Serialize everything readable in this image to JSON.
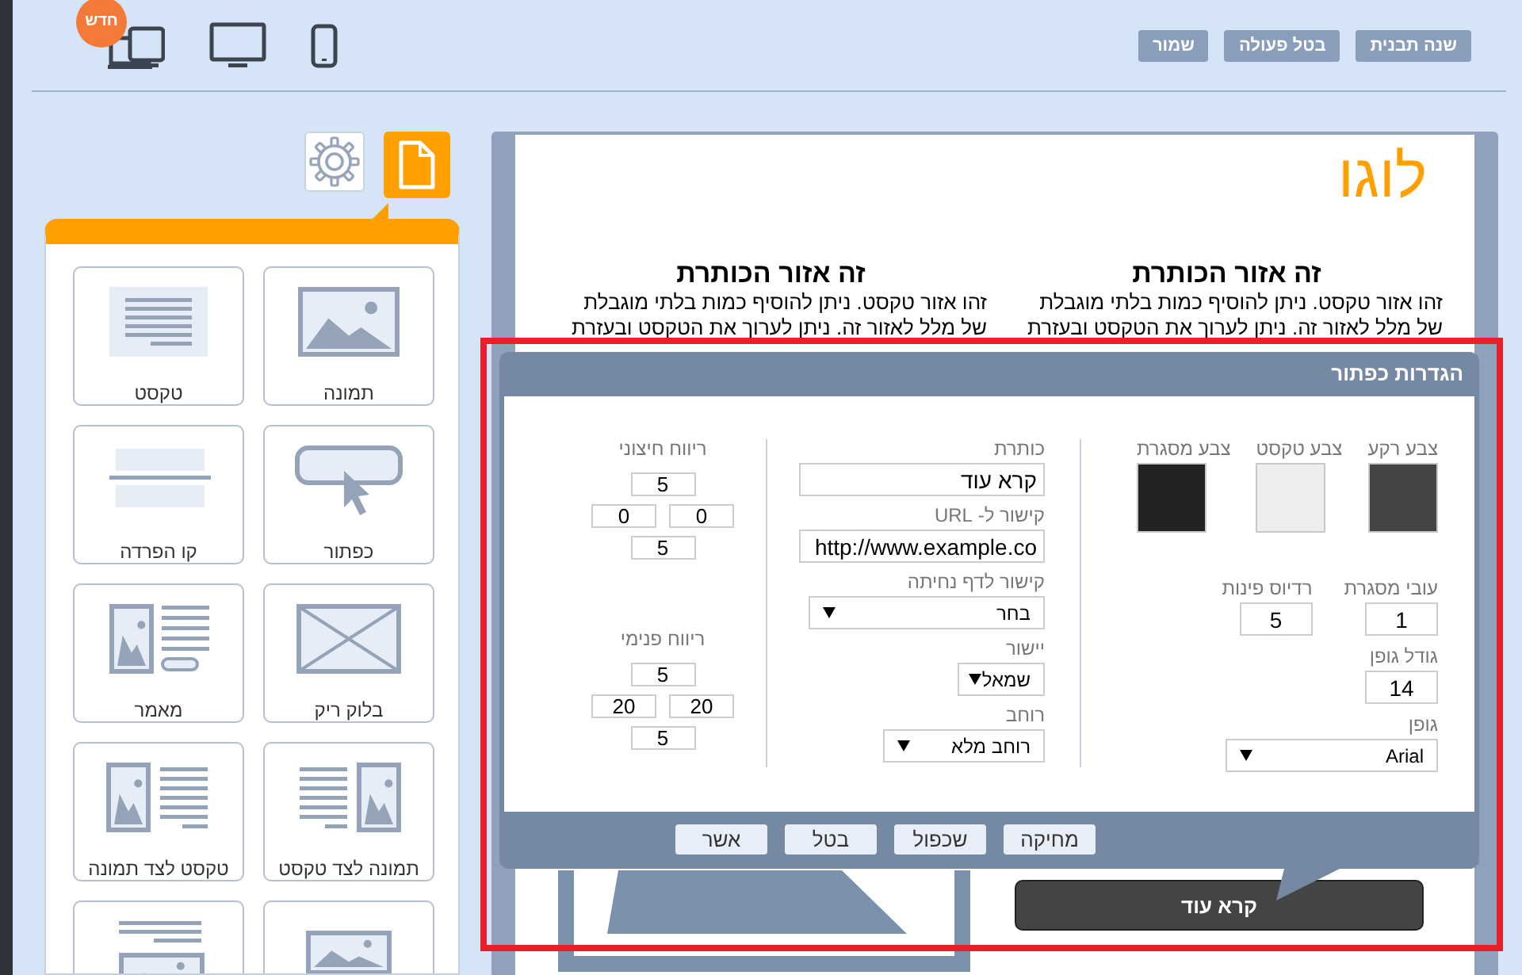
{
  "top_bar": {
    "devices": [
      {
        "kind": "multi-device",
        "badge": "חדש"
      },
      {
        "kind": "desktop"
      },
      {
        "kind": "mobile"
      }
    ],
    "buttons": [
      "שנה תבנית",
      "בטל פעולה",
      "שמור"
    ]
  },
  "sidebar": {
    "tabs": [
      {
        "kind": "page",
        "selected": true
      },
      {
        "kind": "settings",
        "selected": false
      }
    ],
    "tiles": [
      {
        "kind": "image",
        "label": "תמונה"
      },
      {
        "kind": "text",
        "label": "טקסט"
      },
      {
        "kind": "button",
        "label": "כפתור"
      },
      {
        "kind": "divider",
        "label": "קו הפרדה"
      },
      {
        "kind": "blank",
        "label": "בלוק ריק"
      },
      {
        "kind": "article",
        "label": "מאמר"
      },
      {
        "kind": "image-beside-text",
        "label": "תמונה לצד טקסט"
      },
      {
        "kind": "text-beside-image",
        "label": "טקסט לצד תמונה"
      },
      {
        "kind": "image-small"
      },
      {
        "kind": "text-above-image"
      }
    ]
  },
  "canvas": {
    "logo": "לוגו",
    "columns": [
      {
        "heading": "זה אזור הכותרת",
        "text": "זהו אזור טקסט. ניתן להוסיף כמות בלתי מוגבלת\nשל מלל לאזור זה. ניתן לערוך את הטקסט ובעזרת"
      },
      {
        "heading": "זה אזור הכותרת",
        "text": "זהו אזור טקסט. ניתן להוסיף כמות בלתי מוגבלת\nשל מלל לאזור זה. ניתן לערוך את הטקסט ובעזרת"
      }
    ],
    "button": "קרא עוד"
  },
  "dialog": {
    "title": "הגדרות כפתור",
    "colors": [
      {
        "label": "צבע רקע",
        "color": "#444444"
      },
      {
        "label": "צבע טקסט",
        "color": "#eeeeee"
      },
      {
        "label": "צבע מסגרת",
        "color": "#222222"
      }
    ],
    "border_width": {
      "label": "עובי מסגרת",
      "value": "1"
    },
    "corner_radius": {
      "label": "רדיוס פינות",
      "value": "5"
    },
    "font_size": {
      "label": "גודל גופן",
      "value": "14"
    },
    "font": {
      "label": "גופן",
      "value": "Arial"
    },
    "caption": {
      "label": "כותרת",
      "value": "קרא עוד"
    },
    "url": {
      "label": "קישור ל- URL",
      "value": "http://www.example.co"
    },
    "landing_page": {
      "label": "קישור לדף נחיתה",
      "value": "בחר"
    },
    "alignment": {
      "label": "יישור",
      "value": "שמאל"
    },
    "width": {
      "label": "רוחב",
      "value": "רוחב מלא"
    },
    "outer_spacing": {
      "label": "ריווח חיצוני",
      "values": [
        "5",
        "0",
        "0",
        "5"
      ]
    },
    "inner_spacing": {
      "label": "ריווח פנימי",
      "values": [
        "5",
        "20",
        "20",
        "5"
      ]
    },
    "buttons": [
      "מחיקה",
      "שכפול",
      "בטל",
      "אשר"
    ]
  }
}
